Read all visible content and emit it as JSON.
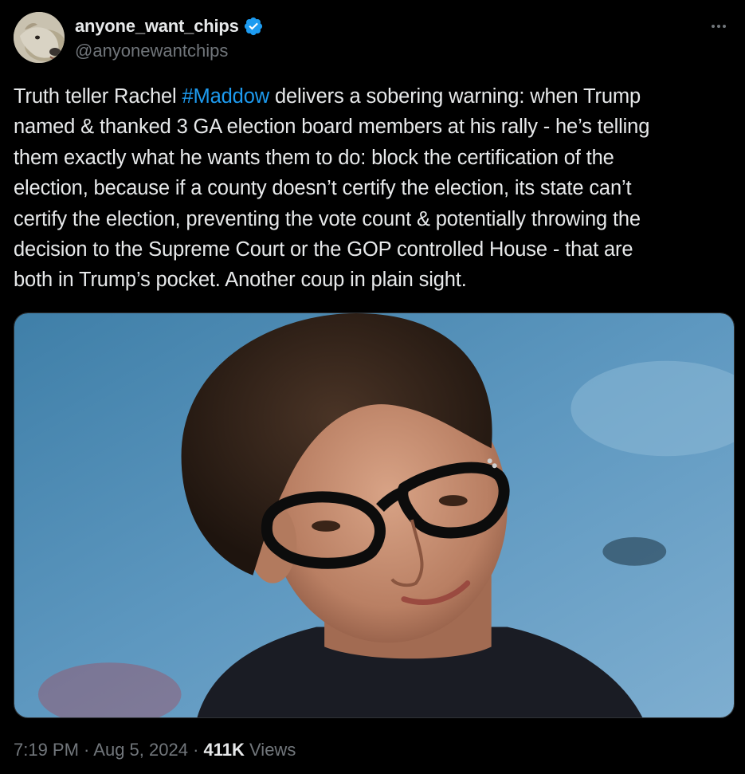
{
  "author": {
    "display_name": "anyone_want_chips",
    "handle": "@anyonewantchips",
    "verified": true,
    "avatar_icon": "greyhound-dog-avatar"
  },
  "tweet": {
    "text_lines": [
      {
        "before": "Truth teller Rachel ",
        "hashtag": "#Maddow",
        "after": " delivers a sobering warning: when Trump"
      },
      {
        "text": "named & thanked 3 GA election board members at his rally - he’s telling"
      },
      {
        "text": "them exactly what he wants them to do: block the certification of the"
      },
      {
        "text": "election, because if a county doesn’t certify the election, its state can’t"
      },
      {
        "text": "certify the election, preventing the vote count & potentially throwing the"
      },
      {
        "text": "decision to the Supreme Court or the GOP controlled House - that are"
      },
      {
        "text": "both in Trump’s pocket. Another coup in plain sight."
      }
    ],
    "hashtag_color": "#1d9bf0",
    "image_subject": "photo-portrait"
  },
  "meta": {
    "time": "7:19 PM",
    "separator": " · ",
    "date": "Aug 5, 2024",
    "views_count": "411K",
    "views_label": "Views"
  },
  "colors": {
    "background": "#000000",
    "text_primary": "#e7e9ea",
    "text_secondary": "#71767b",
    "accent": "#1d9bf0"
  }
}
